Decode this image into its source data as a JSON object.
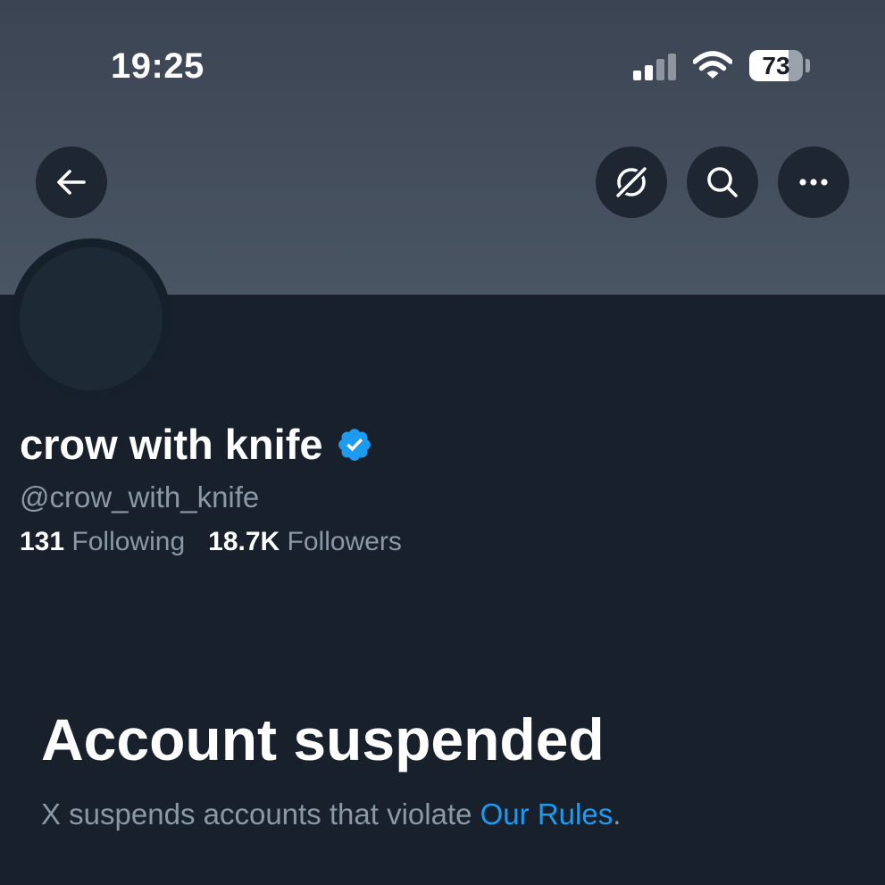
{
  "status_bar": {
    "time": "19:25",
    "battery_level": "73",
    "battery_fraction": 0.73,
    "signal_bars_active": 2,
    "signal_bars_total": 4
  },
  "header": {
    "back_icon": "arrow-left-icon",
    "grok_icon": "grok-icon",
    "search_icon": "search-icon",
    "more_icon": "more-horizontal-icon"
  },
  "profile": {
    "display_name": "crow with knife",
    "handle": "@crow_with_knife",
    "following_count": "131",
    "following_label": "Following",
    "followers_count": "18.7K",
    "followers_label": "Followers",
    "verified_icon": "verified-badge-icon"
  },
  "suspension": {
    "title": "Account suspended",
    "message_prefix": "X suspends accounts that violate ",
    "rules_link": "Our Rules",
    "message_suffix": "."
  },
  "colors": {
    "banner": "#3b4452",
    "background": "#17202b",
    "text_primary": "#ffffff",
    "text_secondary": "#8b98a5",
    "accent": "#1d9bf0"
  }
}
